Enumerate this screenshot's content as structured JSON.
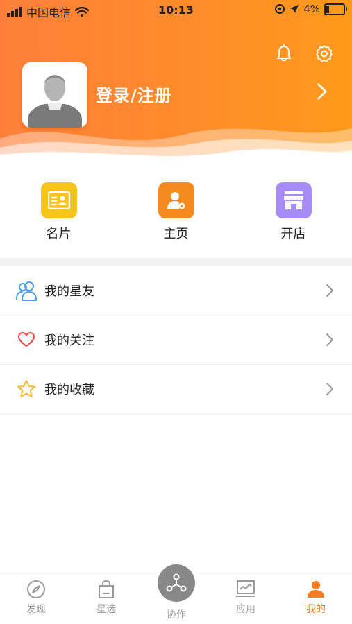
{
  "status_bar": {
    "carrier": "中国电信",
    "time": "10:13",
    "battery_percent": "4%"
  },
  "header": {
    "login_label": "登录/注册",
    "bell_icon": "bell-icon",
    "settings_icon": "gear-icon"
  },
  "quick_actions": [
    {
      "label": "名片",
      "icon": "card-icon",
      "color": "#f7c41e"
    },
    {
      "label": "主页",
      "icon": "homepage-user-gear-icon",
      "color": "#f58a1f"
    },
    {
      "label": "开店",
      "icon": "store-icon",
      "color": "#a88cf5"
    }
  ],
  "menu": [
    {
      "label": "我的星友",
      "icon": "friends-icon",
      "color": "#4a9df0"
    },
    {
      "label": "我的关注",
      "icon": "heart-icon",
      "color": "#e84a4a"
    },
    {
      "label": "我的收藏",
      "icon": "star-icon",
      "color": "#f5b82e"
    }
  ],
  "tabbar": {
    "items": [
      {
        "label": "发现",
        "icon": "compass-icon",
        "active": false
      },
      {
        "label": "星选",
        "icon": "shopping-bag-icon",
        "active": false
      },
      {
        "label": "协作",
        "icon": "collaboration-icon",
        "active": false
      },
      {
        "label": "应用",
        "icon": "monitor-chart-icon",
        "active": false
      },
      {
        "label": "我的",
        "icon": "profile-icon",
        "active": true
      }
    ],
    "active_color": "#f57e21",
    "inactive_color": "#999999"
  }
}
